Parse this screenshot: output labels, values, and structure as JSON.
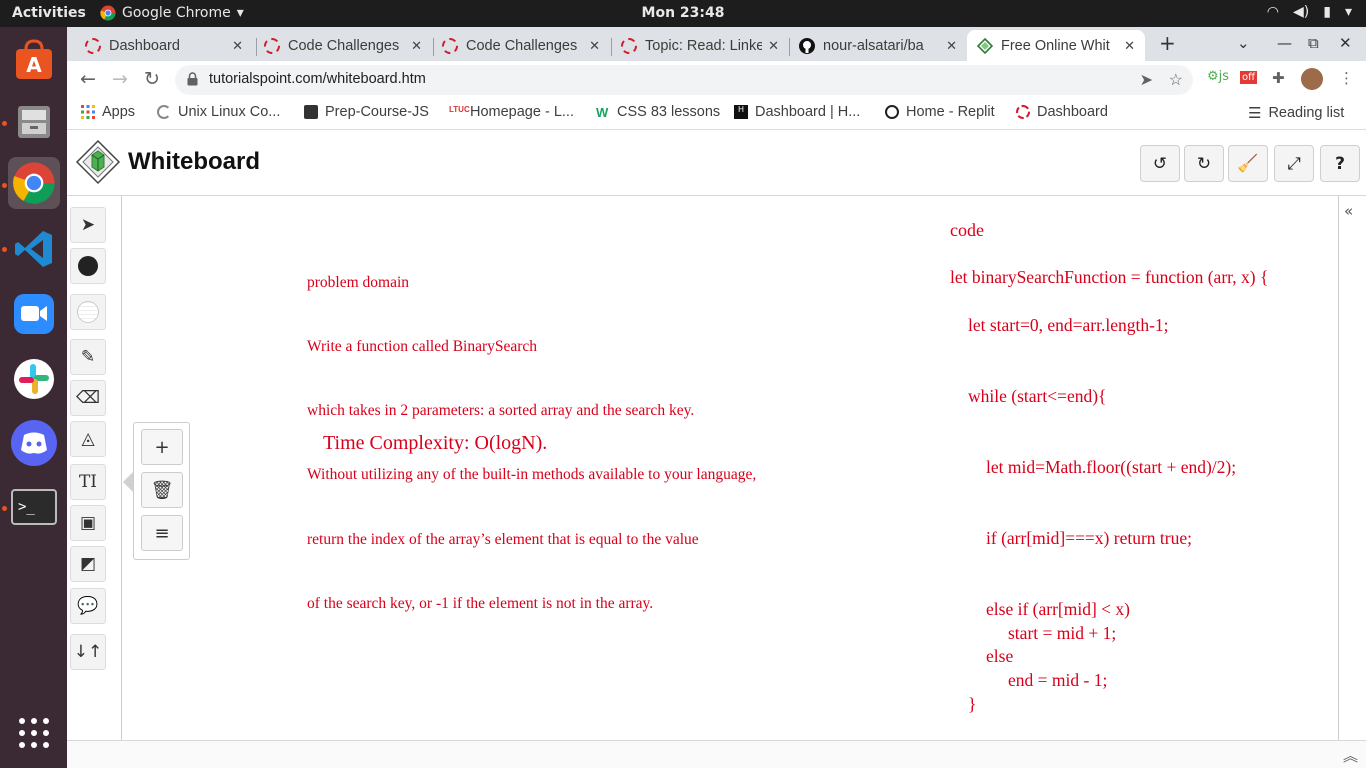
{
  "system": {
    "activities": "Activities",
    "app_name": "Google Chrome",
    "clock": "Mon 23:48"
  },
  "browser": {
    "tabs": [
      {
        "title": "Dashboard"
      },
      {
        "title": "Code Challenges"
      },
      {
        "title": "Code Challenges"
      },
      {
        "title": "Topic: Read: Linked"
      },
      {
        "title": "nour-alsatari/ba"
      },
      {
        "title": "Free Online Whit"
      }
    ],
    "url": "tutorialspoint.com/whiteboard.htm",
    "bookmarks": [
      {
        "label": "Apps"
      },
      {
        "label": "Unix Linux Co..."
      },
      {
        "label": "Prep-Course-JS"
      },
      {
        "label": "Homepage - L..."
      },
      {
        "label": "CSS 83 lessons"
      },
      {
        "label": "Dashboard | H..."
      },
      {
        "label": "Home - Replit"
      },
      {
        "label": "Dashboard"
      }
    ],
    "reading_list": "Reading list"
  },
  "whiteboard": {
    "title": "Whiteboard",
    "problem_lines": [
      "problem domain",
      "Write a function called BinarySearch",
      "which takes in 2 parameters: a sorted array and the search key.",
      "Without utilizing any of the built-in methods available to your language,",
      "return the index of the array’s element that is equal to the value",
      "of the search key, or -1 if the element is not in the array."
    ],
    "complexity": "Time Complexity: O(logN).",
    "code_title": "code",
    "code_lines": [
      "let binarySearchFunction = function (arr, x) {",
      "let start=0, end=arr.length-1;",
      "while (start<=end){",
      "let mid=Math.floor((start + end)/2);",
      "if (arr[mid]===x) return true;",
      "else if (arr[mid] < x)",
      "start = mid + 1;",
      "else",
      "end = mid - 1;",
      "}"
    ],
    "text_color": "#d8001a"
  }
}
